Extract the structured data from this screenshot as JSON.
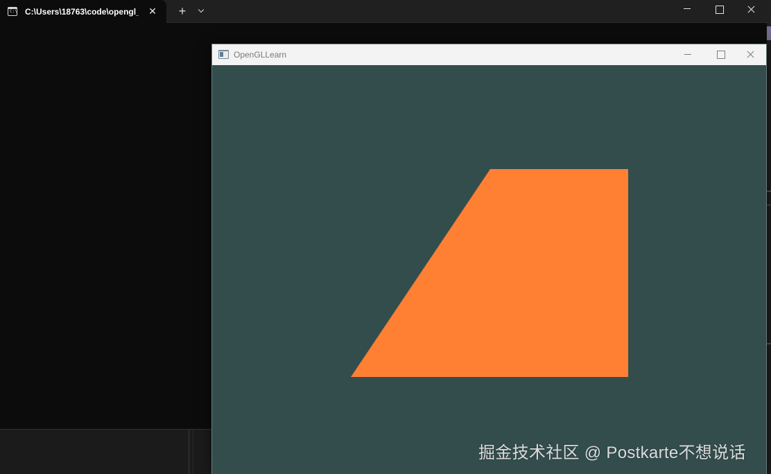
{
  "terminal": {
    "tab_title": "C:\\Users\\18763\\code\\opengl_p",
    "tab_icon": "console-icon",
    "new_tab_glyph": "+",
    "close_glyph": "✕"
  },
  "gl_window": {
    "title": "OpenGLLearn",
    "icon": "app-window-icon",
    "clear_color": "#334d4d",
    "shape_color": "#ff7f33"
  },
  "watermark": "掘金技术社区 @ Postkarte不想说话"
}
